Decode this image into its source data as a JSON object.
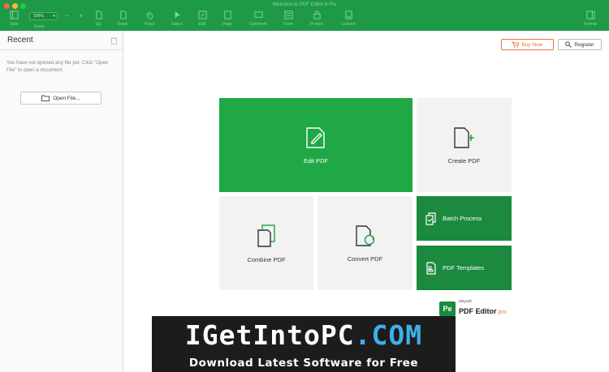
{
  "window": {
    "title": "Welcome to PDF Editor 6 Pro"
  },
  "toolbar": {
    "view": "View",
    "zoom_value": "100%",
    "zoom_label": "Zoom",
    "zoom_minus": "−",
    "zoom_plus": "+",
    "up": "Up",
    "down": "Down",
    "hand": "Hand",
    "select": "Select",
    "edit": "Edit",
    "page": "Page",
    "comment": "Comment",
    "form": "Form",
    "protect": "Protect",
    "convert": "Convert",
    "format": "Format"
  },
  "sidebar": {
    "title": "Recent",
    "empty_message": "You have not opened any file yet. Click \"Open File\" to open a document.",
    "open_button": "Open File..."
  },
  "header": {
    "buy_now": "Buy Now",
    "register": "Register"
  },
  "tiles": {
    "edit_pdf": "Edit PDF",
    "create_pdf": "Create PDF",
    "combine_pdf": "Combine PDF",
    "convert_pdf": "Convert PDF",
    "batch_process": "Batch Process",
    "pdf_templates": "PDF Templates"
  },
  "brand": {
    "mark": "Pe",
    "company": "iSkysoft",
    "product": "PDF Editor",
    "edition": "pro"
  },
  "watermark": {
    "headline_part1": "IGetIntoPC",
    "headline_part2": ".COM",
    "tagline": "Download Latest Software for Free"
  },
  "colors": {
    "brand_green": "#1e9a46",
    "tile_green": "#1fa845",
    "tile_dark": "#1b8a3f",
    "accent_orange": "#e8743b"
  }
}
